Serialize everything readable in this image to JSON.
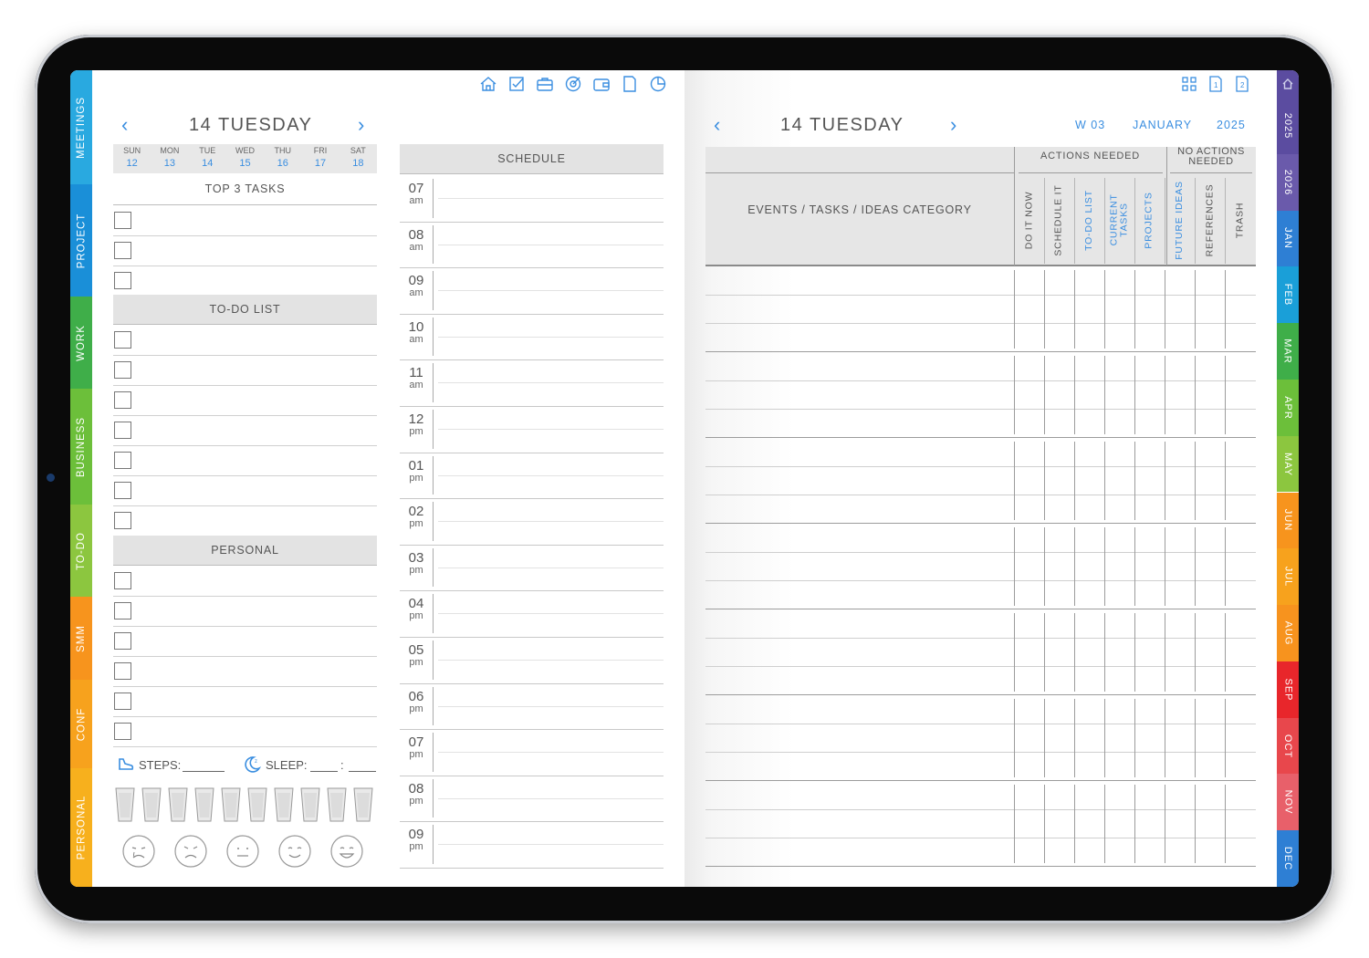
{
  "left_tabs": [
    {
      "label": "MEETINGS",
      "color": "#29a9e0"
    },
    {
      "label": "PROJECT",
      "color": "#1a8fd8"
    },
    {
      "label": "WORK",
      "color": "#3fae49"
    },
    {
      "label": "BUSINESS",
      "color": "#6cbf3a"
    },
    {
      "label": "TO-DO",
      "color": "#8cc63f"
    },
    {
      "label": "SMM",
      "color": "#f7941d"
    },
    {
      "label": "CONF",
      "color": "#f7a21d"
    },
    {
      "label": "PERSONAL",
      "color": "#f7b01d"
    }
  ],
  "right_tabs": [
    {
      "label": "2025",
      "color": "#5b4ca0"
    },
    {
      "label": "2026",
      "color": "#6a5aab"
    },
    {
      "label": "JAN",
      "color": "#2e7fd4"
    },
    {
      "label": "FEB",
      "color": "#1a9fd8"
    },
    {
      "label": "MAR",
      "color": "#3fae49"
    },
    {
      "label": "APR",
      "color": "#6cbf3a"
    },
    {
      "label": "MAY",
      "color": "#8cc63f"
    },
    {
      "label": "JUN",
      "color": "#f7941d"
    },
    {
      "label": "JUL",
      "color": "#f7a21d"
    },
    {
      "label": "AUG",
      "color": "#f7931e"
    },
    {
      "label": "SEP",
      "color": "#e8262b"
    },
    {
      "label": "OCT",
      "color": "#e8474c"
    },
    {
      "label": "NOV",
      "color": "#e8606a"
    },
    {
      "label": "DEC",
      "color": "#2e7fd4"
    }
  ],
  "left_page": {
    "nav_icons": [
      "home-icon",
      "check-icon",
      "briefcase-icon",
      "target-icon",
      "wallet-icon",
      "note-icon",
      "pie-chart-icon"
    ],
    "date_title": "14 TUESDAY",
    "week": [
      {
        "name": "SUN",
        "day": "12"
      },
      {
        "name": "MON",
        "day": "13"
      },
      {
        "name": "TUE",
        "day": "14"
      },
      {
        "name": "WED",
        "day": "15"
      },
      {
        "name": "THU",
        "day": "16"
      },
      {
        "name": "FRI",
        "day": "17"
      },
      {
        "name": "SAT",
        "day": "18"
      }
    ],
    "top3_label": "TOP 3 TASKS",
    "todo_label": "TO-DO LIST",
    "personal_label": "PERSONAL",
    "schedule_label": "SCHEDULE",
    "hours": [
      {
        "h": "07",
        "p": "am"
      },
      {
        "h": "08",
        "p": "am"
      },
      {
        "h": "09",
        "p": "am"
      },
      {
        "h": "10",
        "p": "am"
      },
      {
        "h": "11",
        "p": "am"
      },
      {
        "h": "12",
        "p": "pm"
      },
      {
        "h": "01",
        "p": "pm"
      },
      {
        "h": "02",
        "p": "pm"
      },
      {
        "h": "03",
        "p": "pm"
      },
      {
        "h": "04",
        "p": "pm"
      },
      {
        "h": "05",
        "p": "pm"
      },
      {
        "h": "06",
        "p": "pm"
      },
      {
        "h": "07",
        "p": "pm"
      },
      {
        "h": "08",
        "p": "pm"
      },
      {
        "h": "09",
        "p": "pm"
      }
    ],
    "steps_label": "STEPS:",
    "sleep_label": "SLEEP:",
    "sleep_sep": ":"
  },
  "right_page": {
    "nav_icons": [
      "layout-grid-icon",
      "page-1-icon",
      "page-2-icon"
    ],
    "date_title": "14 TUESDAY",
    "week_label": "W 03",
    "month_label": "JANUARY",
    "year_label": "2025",
    "events_header": "EVENTS / TASKS / IDEAS CATEGORY",
    "actions_needed": "ACTIONS NEEDED",
    "no_actions_needed": "NO ACTIONS NEEDED",
    "columns": [
      {
        "label": "DO IT NOW",
        "color": "#555555"
      },
      {
        "label": "SCHEDULE IT",
        "color": "#555555"
      },
      {
        "label": "TO-DO LIST",
        "color": "#3a8ee0"
      },
      {
        "label": "CURRENT TASKS",
        "color": "#3a8ee0"
      },
      {
        "label": "PROJECTS",
        "color": "#3a8ee0"
      },
      {
        "label": "FUTURE IDEAS",
        "color": "#3a8ee0"
      },
      {
        "label": "REFERENCES",
        "color": "#555555"
      },
      {
        "label": "TRASH",
        "color": "#555555"
      }
    ]
  }
}
